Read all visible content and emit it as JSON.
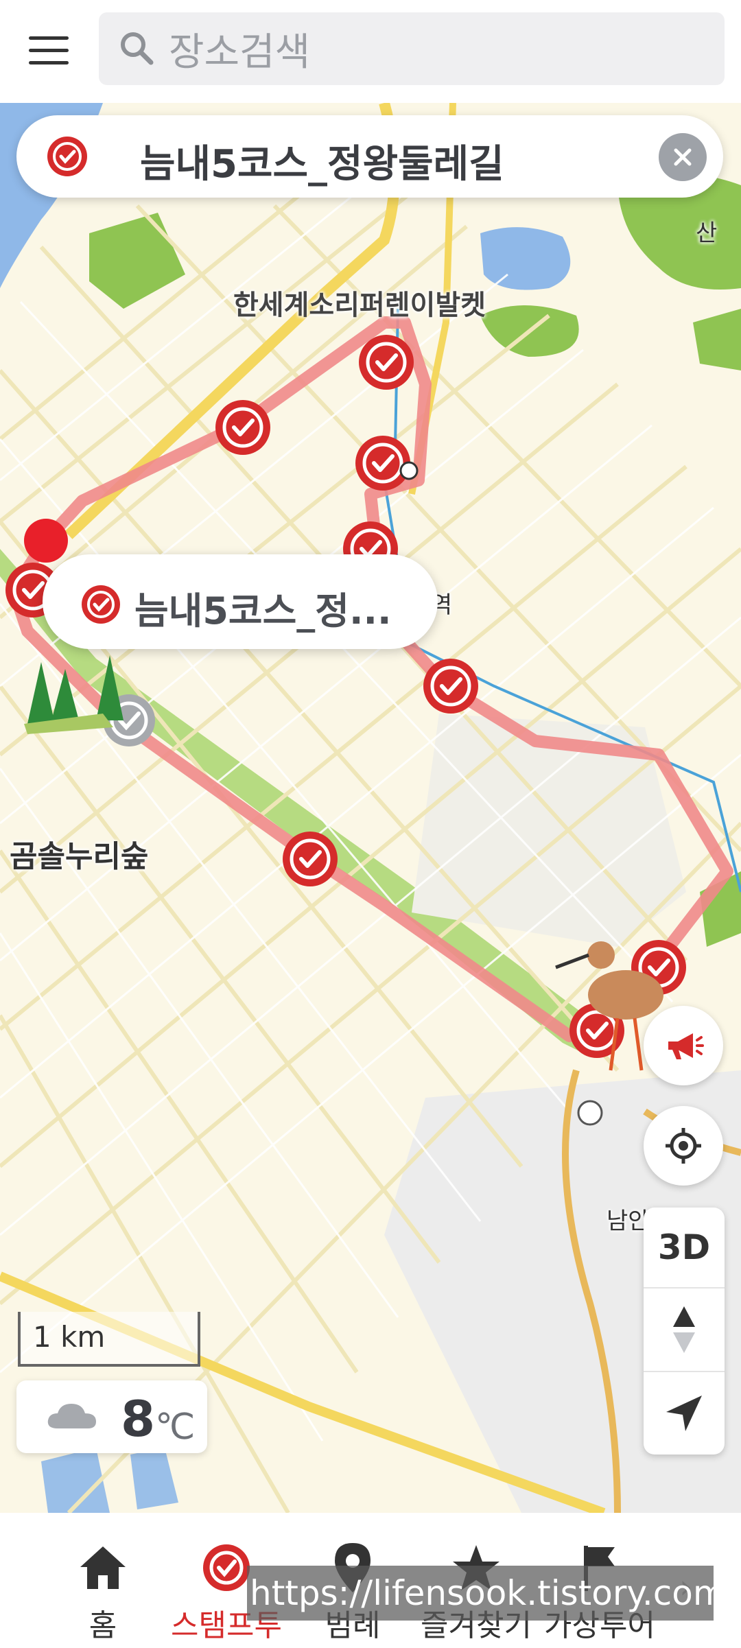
{
  "search": {
    "placeholder": "장소검색"
  },
  "course": {
    "title": "늠내5코스_정왕둘레길",
    "popup_title": "늠내5코스_정..."
  },
  "map_labels": {
    "forest": "곰솔누리숲",
    "station": "오이도역",
    "interchange": "남안산",
    "north_partial": "한세계소리퍼렌이발켓",
    "ne_partial": "산"
  },
  "controls": {
    "three_d": "3D"
  },
  "scale": {
    "label": "1 km"
  },
  "weather": {
    "temperature": "8",
    "unit": "℃",
    "icon": "cloud-icon"
  },
  "bottom_nav": {
    "items": [
      {
        "label": "홈",
        "icon": "home-icon"
      },
      {
        "label": "스탬프투어",
        "icon": "stamp-icon",
        "active": true
      },
      {
        "label": "범례",
        "icon": "pin-icon"
      },
      {
        "label": "즐겨찾기",
        "icon": "star-icon"
      },
      {
        "label": "가상투어",
        "icon": "flag-icon"
      }
    ]
  },
  "watermark": "https://lifensook.tistory.com",
  "colors": {
    "accent": "#d52b2b",
    "route": "#f08a8a",
    "park": "#8bc34a",
    "water": "#7fb0e6"
  }
}
